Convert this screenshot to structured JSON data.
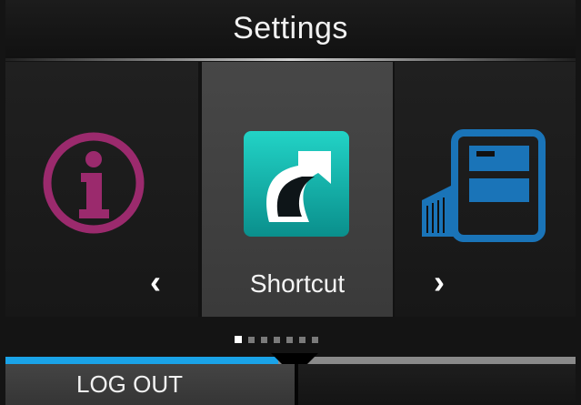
{
  "header": {
    "title": "Settings"
  },
  "carousel": {
    "items": [
      {
        "label": "",
        "icon": "info-icon",
        "color": "#9b2a6d"
      },
      {
        "label": "Shortcut",
        "icon": "shortcut-icon",
        "color": "#12b7b0"
      },
      {
        "label": "",
        "icon": "printer-icon",
        "color": "#1a74b8"
      }
    ],
    "selected_index": 1,
    "prev_arrow": "‹",
    "next_arrow": "›",
    "page_count": 7,
    "active_page": 1
  },
  "footer": {
    "logout_label": "LOG OUT"
  },
  "colors": {
    "accent": "#1aa3e8",
    "background": "#141414"
  }
}
